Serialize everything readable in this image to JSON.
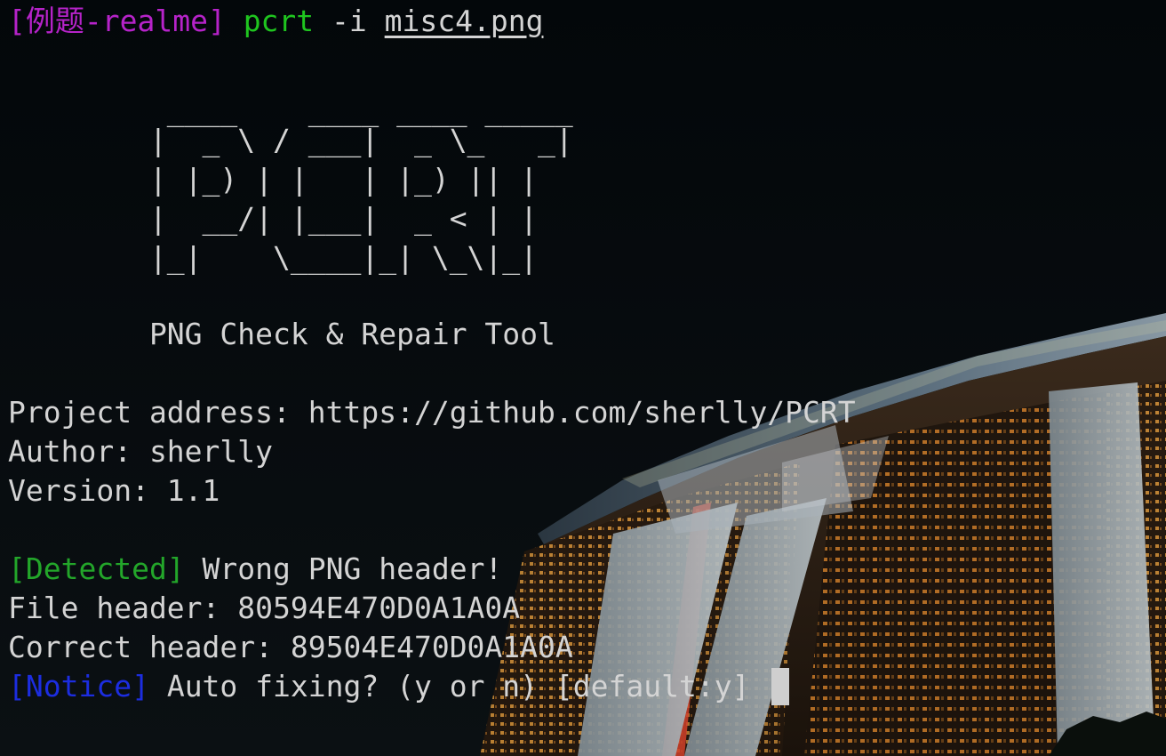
{
  "prompt": {
    "context": "[例题-realme]",
    "command": "pcrt",
    "flag": "-i",
    "argument": "misc4.png"
  },
  "banner": {
    "ascii_lines": [
      "         ____    ____ ____ _____",
      "        |  _ \\ / ___|  _ \\_   _|",
      "        | |_) | |   | |_) || |",
      "        |  __/| |___|  _ < | |",
      "        |_|    \\____|_| \\_\\|_|"
    ],
    "tagline": "        PNG Check & Repair Tool"
  },
  "info": {
    "project": "Project address: https://github.com/sherlly/PCRT",
    "author": "Author: sherlly",
    "version": "Version: 1.1"
  },
  "output": {
    "detected_tag": "[Detected]",
    "detected_message": " Wrong PNG header!",
    "file_header": "File header: 80594E470D0A1A0A",
    "correct_header": "Correct header: 89504E470D0A1A0A",
    "notice_tag": "[Notice]",
    "notice_message": " Auto fixing? (y or n) [default:y] "
  },
  "colors": {
    "background": "#060a0c",
    "prompt_context": "#b623c9",
    "command": "#1fc51f",
    "detected_tag": "#23a62a",
    "notice_tag": "#1c2de0",
    "text": "#d4d4d4",
    "cursor": "#cfcfcf"
  }
}
